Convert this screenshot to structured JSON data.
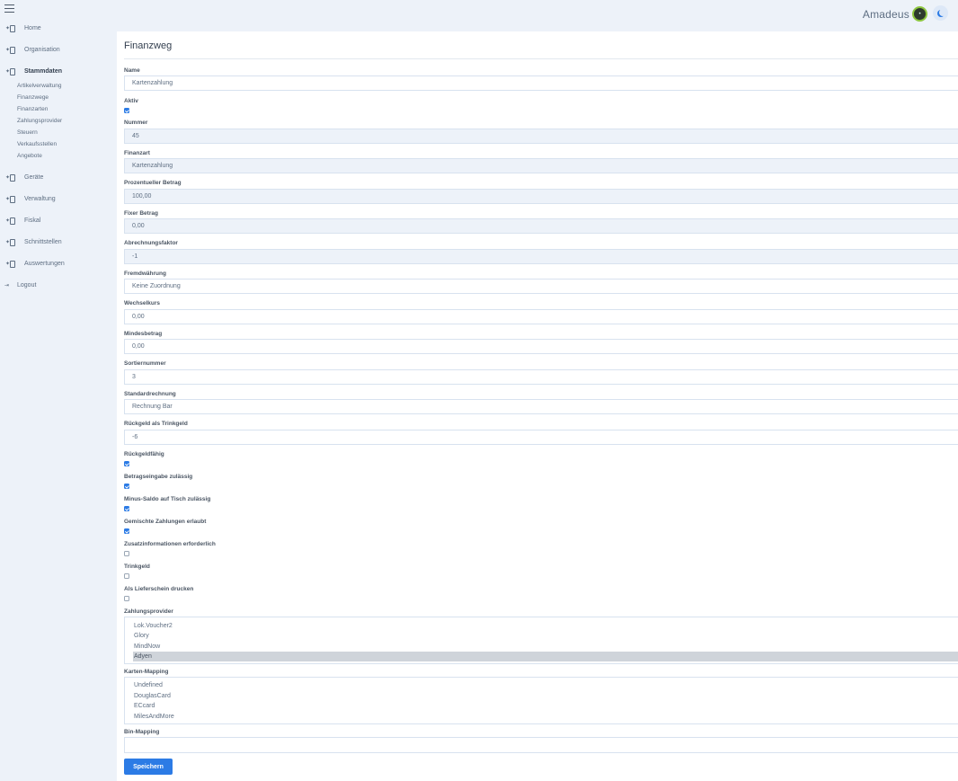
{
  "header": {
    "brand": "Amadeus"
  },
  "sidebar": {
    "items": [
      {
        "label": "Home"
      },
      {
        "label": "Organisation"
      },
      {
        "label": "Stammdaten"
      },
      {
        "label": "Geräte"
      },
      {
        "label": "Verwaltung"
      },
      {
        "label": "Fiskal"
      },
      {
        "label": "Schnittstellen"
      },
      {
        "label": "Auswertungen"
      }
    ],
    "subitems": [
      "Artikelverwaltung",
      "Finanzwege",
      "Finanzarten",
      "Zahlungsprovider",
      "Steuern",
      "Verkaufsstellen",
      "Angebote"
    ],
    "logout": "Logout"
  },
  "page": {
    "title": "Finanzweg"
  },
  "form": {
    "name": {
      "label": "Name",
      "value": "Kartenzahlung"
    },
    "aktiv": {
      "label": "Aktiv",
      "checked": true
    },
    "nummer": {
      "label": "Nummer",
      "value": "45"
    },
    "finanzart": {
      "label": "Finanzart",
      "value": "Kartenzahlung"
    },
    "prozentueller_betrag": {
      "label": "Prozentueller Betrag",
      "value": "100,00"
    },
    "fixer_betrag": {
      "label": "Fixer Betrag",
      "value": "0,00"
    },
    "abrechnungsfaktor": {
      "label": "Abrechnungsfaktor",
      "value": "-1"
    },
    "fremdwaehrung": {
      "label": "Fremdwährung",
      "value": "Keine Zuordnung"
    },
    "wechselkurs": {
      "label": "Wechselkurs",
      "value": "0,00"
    },
    "mindestbetrag": {
      "label": "Mindesbetrag",
      "value": "0,00"
    },
    "sortiernummer": {
      "label": "Sortiernummer",
      "value": "3"
    },
    "standardrechnung": {
      "label": "Standardrechnung",
      "value": "Rechnung Bar"
    },
    "rueckgeld_trinkgeld": {
      "label": "Rückgeld als Trinkgeld",
      "value": "-6"
    },
    "rueckgeldfaehig": {
      "label": "Rückgeldfähig",
      "checked": true
    },
    "betragseingabe": {
      "label": "Betragseingabe zulässig",
      "checked": true
    },
    "minus_saldo": {
      "label": "Minus-Saldo auf Tisch zulässig",
      "checked": true
    },
    "gemischte_zahlungen": {
      "label": "Gemischte Zahlungen erlaubt",
      "checked": true
    },
    "zusatzinformationen": {
      "label": "Zusatzinformationen erforderlich",
      "checked": false
    },
    "trinkgeld": {
      "label": "Trinkgeld",
      "checked": false
    },
    "lieferschein": {
      "label": "Als Lieferschein drucken",
      "checked": false
    },
    "zahlungsprovider": {
      "label": "Zahlungsprovider",
      "options": [
        "Lok.Voucher2",
        "Glory",
        "MindNow",
        "Adyen"
      ],
      "selected": "Adyen"
    },
    "karten_mapping": {
      "label": "Karten-Mapping",
      "options": [
        "Undefined",
        "DouglasCard",
        "ECcard",
        "MilesAndMore"
      ]
    },
    "bin_mapping": {
      "label": "Bin-Mapping",
      "value": ""
    }
  },
  "actions": {
    "save": "Speichern"
  },
  "colors": {
    "accent": "#2c7be5",
    "background": "#edf2f9",
    "card": "#ffffff"
  }
}
